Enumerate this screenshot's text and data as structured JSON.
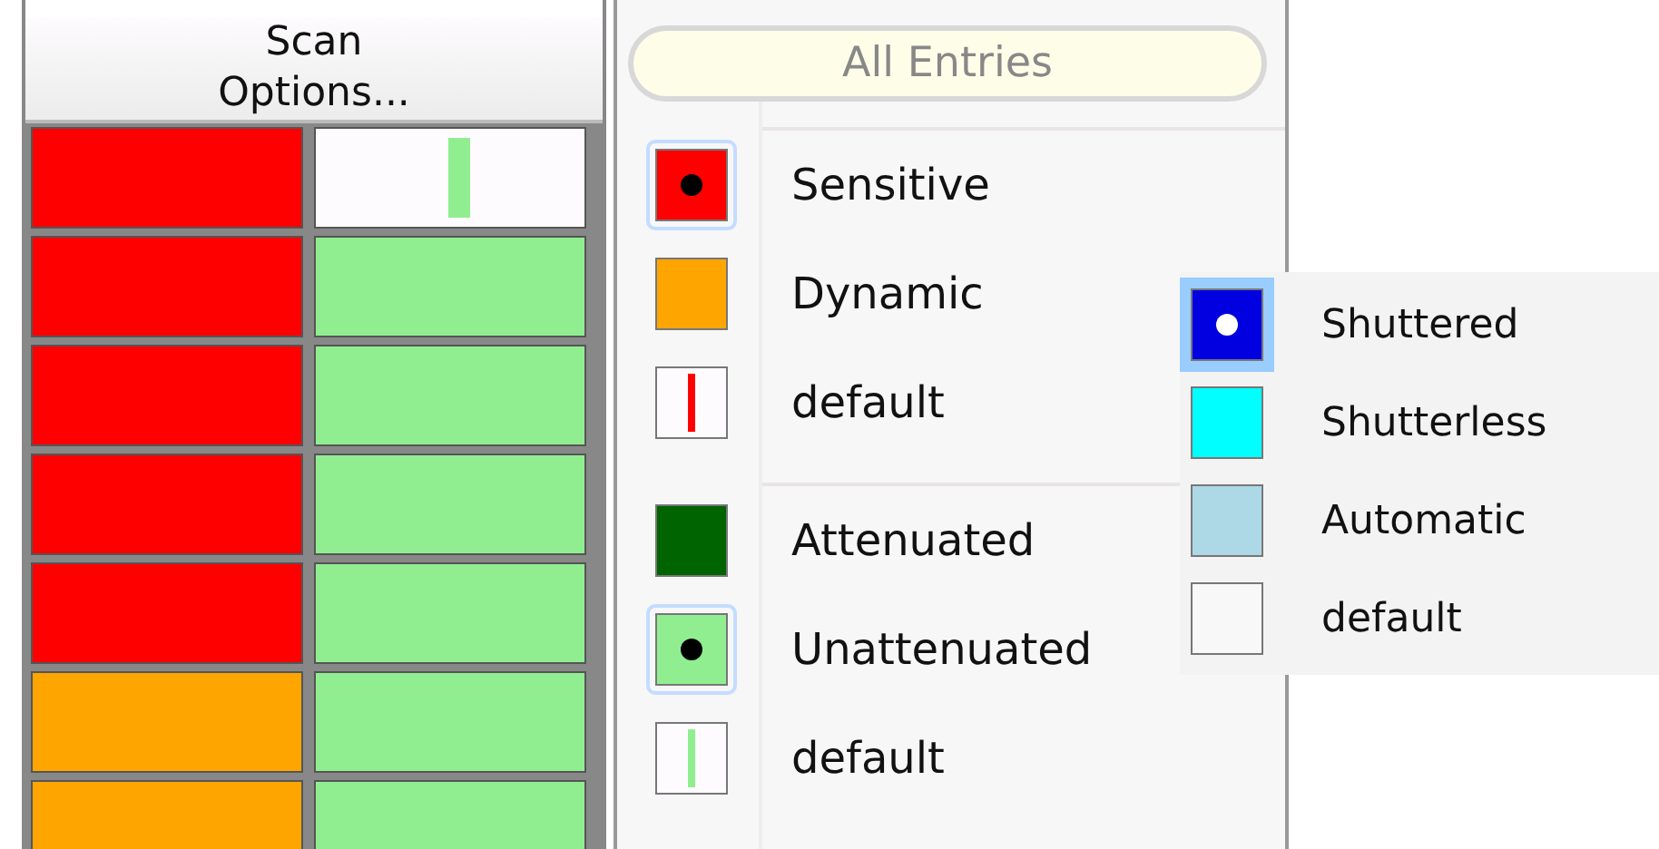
{
  "scan_button": {
    "label": "Scan\nOptions..."
  },
  "grid": {
    "rows": [
      [
        {
          "kind": "solid",
          "color": "#ff0000"
        },
        {
          "kind": "marker",
          "color": "#90ee90"
        }
      ],
      [
        {
          "kind": "solid",
          "color": "#ff0000"
        },
        {
          "kind": "solid",
          "color": "#90ee90"
        }
      ],
      [
        {
          "kind": "solid",
          "color": "#ff0000"
        },
        {
          "kind": "solid",
          "color": "#90ee90"
        }
      ],
      [
        {
          "kind": "solid",
          "color": "#ff0000"
        },
        {
          "kind": "solid",
          "color": "#90ee90"
        }
      ],
      [
        {
          "kind": "solid",
          "color": "#ff0000"
        },
        {
          "kind": "solid",
          "color": "#90ee90"
        }
      ],
      [
        {
          "kind": "solid",
          "color": "#ffa500"
        },
        {
          "kind": "solid",
          "color": "#90ee90"
        }
      ],
      [
        {
          "kind": "solid",
          "color": "#ffa500"
        },
        {
          "kind": "solid",
          "color": "#90ee90"
        }
      ]
    ]
  },
  "filter": {
    "label": "All Entries"
  },
  "legend_groups": [
    {
      "items": [
        {
          "label": "Sensitive",
          "kind": "solid",
          "color": "#ff0000",
          "selected": true
        },
        {
          "label": "Dynamic",
          "kind": "solid",
          "color": "#ffa500",
          "selected": false
        },
        {
          "label": "default",
          "kind": "marker",
          "color": "#ff0000",
          "selected": false
        }
      ]
    },
    {
      "items": [
        {
          "label": "Attenuated",
          "kind": "solid",
          "color": "#006400",
          "selected": false
        },
        {
          "label": "Unattenuated",
          "kind": "solid",
          "color": "#90ee90",
          "selected": true
        },
        {
          "label": "default",
          "kind": "marker",
          "color": "#90ee90",
          "selected": false
        }
      ]
    }
  ],
  "popup": {
    "items": [
      {
        "label": "Shuttered",
        "kind": "solid",
        "color": "#0000e0",
        "selected": true
      },
      {
        "label": "Shutterless",
        "kind": "solid",
        "color": "#00ffff",
        "selected": false
      },
      {
        "label": "Automatic",
        "kind": "solid",
        "color": "#add8e6",
        "selected": false
      },
      {
        "label": "default",
        "kind": "solid",
        "color": "#f8f8f8",
        "selected": false
      }
    ]
  }
}
